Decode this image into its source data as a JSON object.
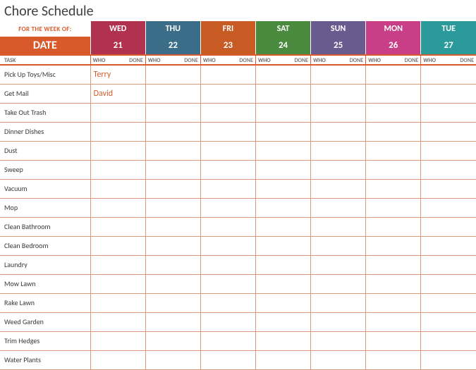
{
  "title": "Chore Schedule",
  "for_week_label": "FOR THE WEEK OF:",
  "date_label": "DATE",
  "task_label": "TASK",
  "who_label": "WHO",
  "done_label": "DONE",
  "days": [
    {
      "name": "WED",
      "num": "21",
      "color": "#b0324f"
    },
    {
      "name": "THU",
      "num": "22",
      "color": "#3b6d89"
    },
    {
      "name": "FRI",
      "num": "23",
      "color": "#c85a23"
    },
    {
      "name": "SAT",
      "num": "24",
      "color": "#4a8a3f"
    },
    {
      "name": "SUN",
      "num": "25",
      "color": "#6a5b8f"
    },
    {
      "name": "MON",
      "num": "26",
      "color": "#c93f87"
    },
    {
      "name": "TUE",
      "num": "27",
      "color": "#2a9a9a"
    }
  ],
  "tasks": [
    {
      "name": "Pick Up Toys/Misc",
      "assignments": [
        "Terry",
        "",
        "",
        "",
        "",
        "",
        ""
      ]
    },
    {
      "name": "Get Mail",
      "assignments": [
        "David",
        "",
        "",
        "",
        "",
        "",
        ""
      ]
    },
    {
      "name": "Take Out Trash",
      "assignments": [
        "",
        "",
        "",
        "",
        "",
        "",
        ""
      ]
    },
    {
      "name": "Dinner Dishes",
      "assignments": [
        "",
        "",
        "",
        "",
        "",
        "",
        ""
      ]
    },
    {
      "name": "Dust",
      "assignments": [
        "",
        "",
        "",
        "",
        "",
        "",
        ""
      ]
    },
    {
      "name": "Sweep",
      "assignments": [
        "",
        "",
        "",
        "",
        "",
        "",
        ""
      ]
    },
    {
      "name": "Vacuum",
      "assignments": [
        "",
        "",
        "",
        "",
        "",
        "",
        ""
      ]
    },
    {
      "name": "Mop",
      "assignments": [
        "",
        "",
        "",
        "",
        "",
        "",
        ""
      ]
    },
    {
      "name": "Clean Bathroom",
      "assignments": [
        "",
        "",
        "",
        "",
        "",
        "",
        ""
      ]
    },
    {
      "name": "Clean Bedroom",
      "assignments": [
        "",
        "",
        "",
        "",
        "",
        "",
        ""
      ]
    },
    {
      "name": "Laundry",
      "assignments": [
        "",
        "",
        "",
        "",
        "",
        "",
        ""
      ]
    },
    {
      "name": "Mow Lawn",
      "assignments": [
        "",
        "",
        "",
        "",
        "",
        "",
        ""
      ]
    },
    {
      "name": "Rake Lawn",
      "assignments": [
        "",
        "",
        "",
        "",
        "",
        "",
        ""
      ]
    },
    {
      "name": "Weed Garden",
      "assignments": [
        "",
        "",
        "",
        "",
        "",
        "",
        ""
      ]
    },
    {
      "name": "Trim Hedges",
      "assignments": [
        "",
        "",
        "",
        "",
        "",
        "",
        ""
      ]
    },
    {
      "name": "Water Plants",
      "assignments": [
        "",
        "",
        "",
        "",
        "",
        "",
        ""
      ]
    }
  ]
}
